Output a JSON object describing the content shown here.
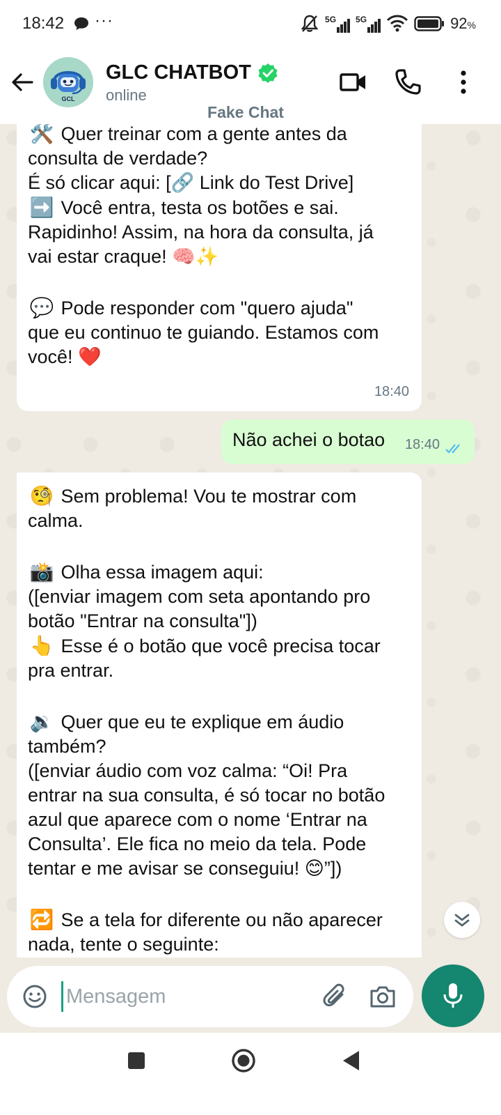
{
  "status_bar": {
    "time": "18:42",
    "dots": "···",
    "signal1": "5G",
    "signal2": "5G",
    "battery": "92",
    "battery_unit": "%"
  },
  "header": {
    "title": "GLC CHATBOT",
    "status": "online",
    "subtitle": "Fake Chat",
    "avatar_text": "GCL"
  },
  "messages": [
    {
      "direction": "in",
      "lines": [
        {
          "icon": "🛠️",
          "text": "Quer treinar com a gente antes da"
        },
        {
          "text": "consulta de verdade?"
        },
        {
          "text": "É só clicar aqui: [🔗 Link do Test Drive]"
        },
        {
          "icon": "➡️",
          "text": "Você entra, testa os botões e sai."
        },
        {
          "text": "Rapidinho! Assim, na hora da consulta, já"
        },
        {
          "text": "vai estar craque! 🧠✨"
        },
        {
          "icon": "💬",
          "text": "Pode responder com \"quero ajuda\""
        },
        {
          "text": "que eu continuo te guiando. Estamos com"
        },
        {
          "text": "você! ❤️"
        }
      ],
      "time": "18:40"
    },
    {
      "direction": "out",
      "text": "Não achei o botao",
      "time": "18:40"
    },
    {
      "direction": "in",
      "lines": [
        {
          "icon": "🧐",
          "text": "Sem problema! Vou te mostrar com"
        },
        {
          "text": "calma."
        },
        {
          "icon": "📸",
          "text": "Olha essa imagem aqui:"
        },
        {
          "text": "([enviar imagem com seta apontando pro"
        },
        {
          "text": "botão \"Entrar na consulta\"])"
        },
        {
          "icon": "👆",
          "text": "Esse é o botão que você precisa tocar"
        },
        {
          "text": "pra entrar."
        },
        {
          "icon": "🔉",
          "text": "Quer que eu te explique em áudio"
        },
        {
          "text": "também?"
        },
        {
          "text": "([enviar áudio com voz calma: “Oi! Pra"
        },
        {
          "text": "entrar na sua consulta, é só tocar no botão"
        },
        {
          "text": "azul que aparece com o nome ‘Entrar na"
        },
        {
          "text": "Consulta’. Ele fica no meio da tela. Pode"
        },
        {
          "text": "tentar e me avisar se conseguiu! 😊”])"
        },
        {
          "icon": "🔁",
          "text": "Se a tela for diferente ou não aparecer"
        },
        {
          "text": "nada, tente o seguinte:"
        }
      ]
    }
  ],
  "composer": {
    "placeholder": "Mensagem"
  },
  "colors": {
    "accent": "#15866f",
    "chat_bg": "#efeae2",
    "outgoing_bubble": "#d9fdd3",
    "incoming_bubble": "#ffffff",
    "read_ticks": "#53bdeb",
    "verified": "#25d366"
  }
}
